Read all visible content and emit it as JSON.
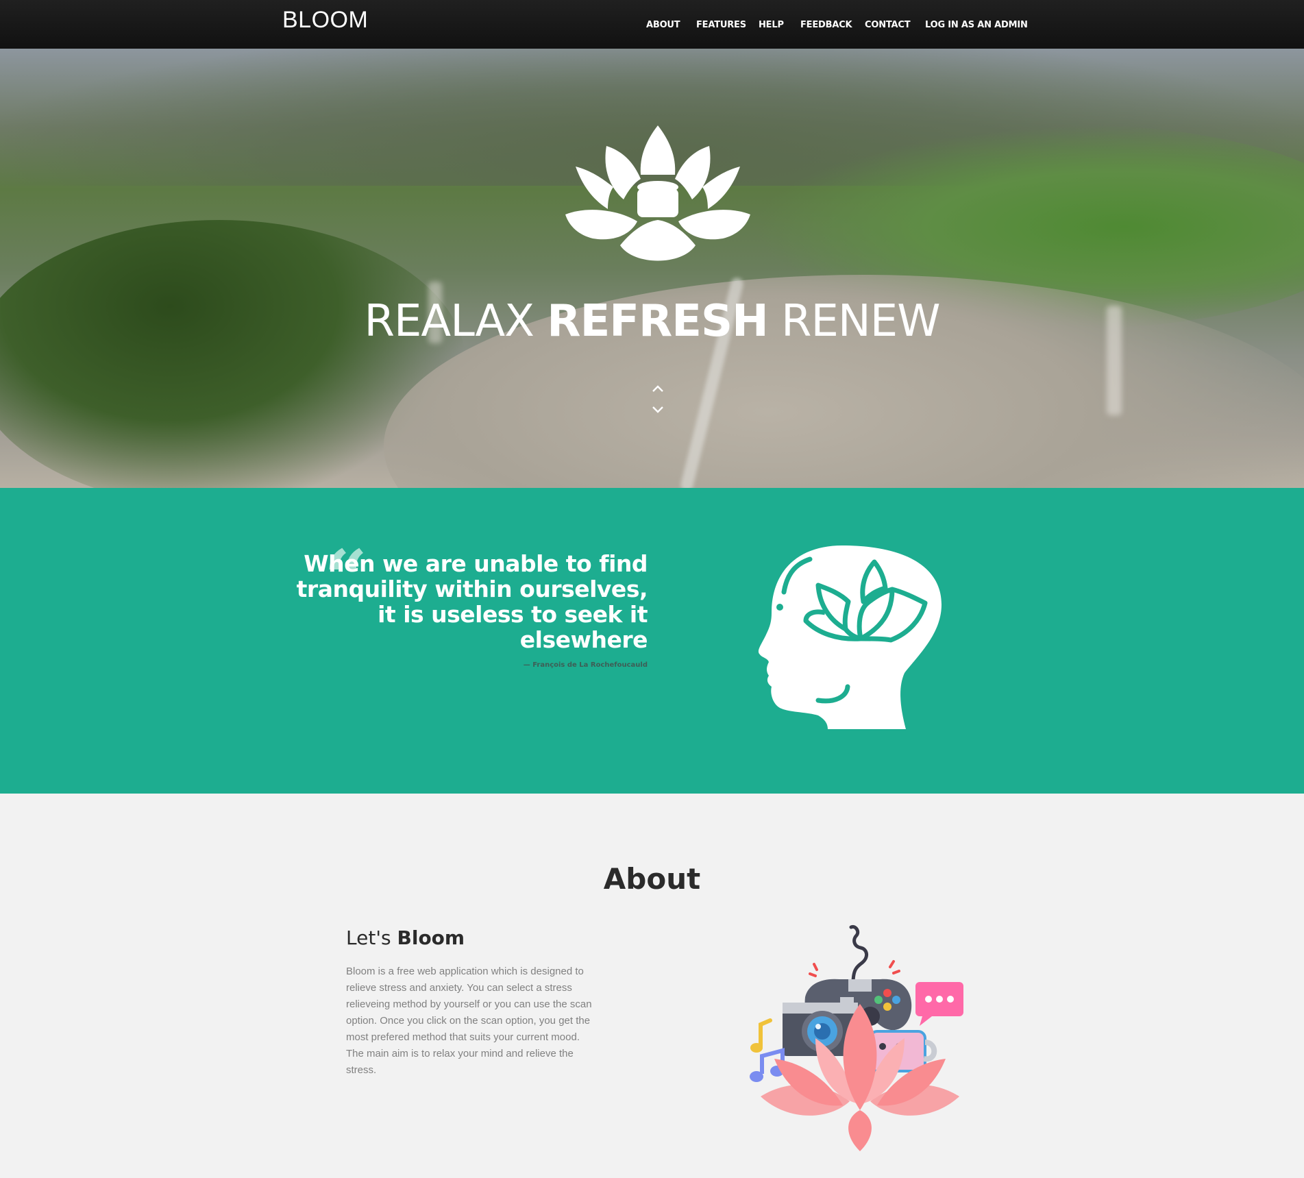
{
  "nav": {
    "brand": "BLOOM",
    "items": [
      "ABOUT",
      "FEATURES",
      "HELP",
      "FEEDBACK",
      "CONTACT",
      "LOG IN AS AN ADMIN"
    ]
  },
  "hero": {
    "tagline_word1": "REALAX",
    "tagline_word2": "REFRESH",
    "tagline_word3": "RENEW",
    "logo_icon": "lotus-icon",
    "scroll_icons": [
      "chevron-up-icon",
      "chevron-down-icon"
    ]
  },
  "quote": {
    "mark": "“",
    "text": "When we are unable to find tranquility within ourselves, it is useless to seek it elsewhere",
    "author": "— François de La Rochefoucauld",
    "icon": "head-lotus-icon"
  },
  "about": {
    "title": "About",
    "subtitle_light": "Let's ",
    "subtitle_bold": "Bloom",
    "body": "Bloom is a free web application which is designed to relieve stress and anxiety. You can select a stress relieveing method by yourself or you can use the scan option. Once you click on the scan option, you get the most prefered method that suits your current mood. The main aim is to relax your mind and relieve the stress.",
    "illustration": "relaxation-activities-illustration"
  },
  "colors": {
    "nav_bg": "#151515",
    "accent_teal": "#1dad90",
    "quote_mark": "#a6e0d2",
    "page_bg": "#f2f2f2",
    "lotus_pink": "#f98c90"
  }
}
